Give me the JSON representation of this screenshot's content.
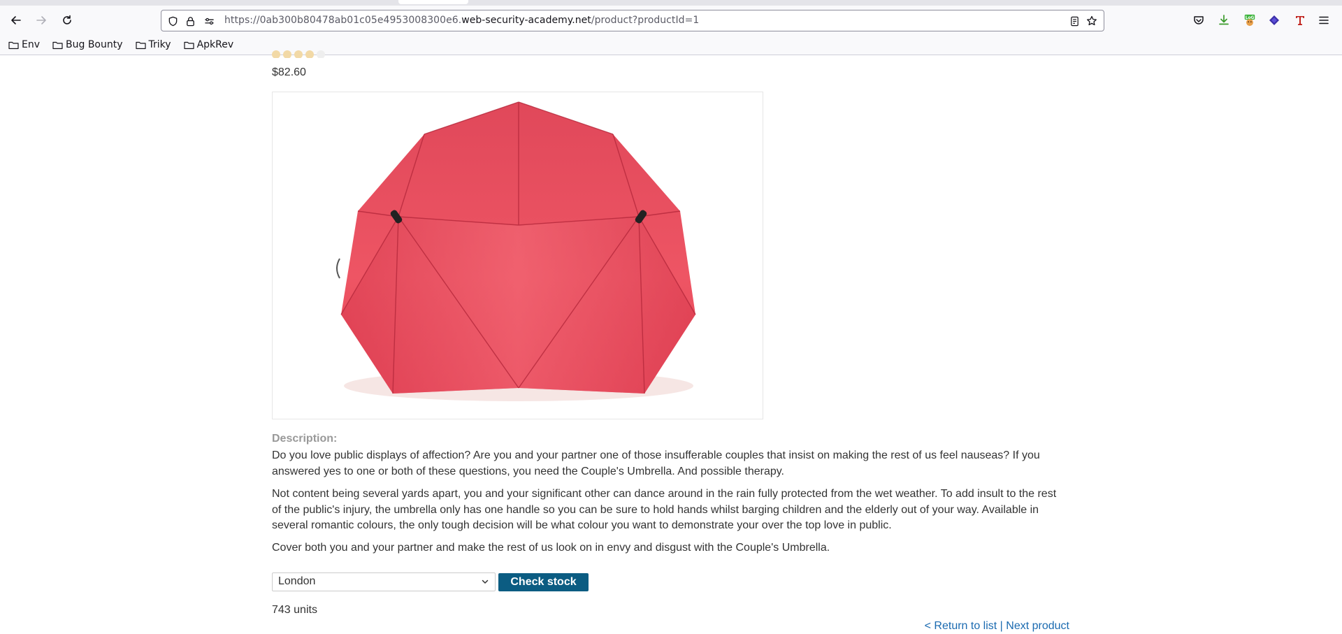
{
  "browser": {
    "url_prefix": "https://0ab300b80478ab01c05e4953008300e6.",
    "url_host": "web-security-academy.net",
    "url_path": "/product?productId=1",
    "bookmarks": [
      "Env",
      "Bug Bounty",
      "Triky",
      "ApkRev"
    ],
    "extension_badge": "LoG"
  },
  "product": {
    "price": "$82.60",
    "image_alt": "Couple's Umbrella",
    "rating_stars": 4
  },
  "description": {
    "heading": "Description:",
    "paragraphs": [
      "Do you love public displays of affection? Are you and your partner one of those insufferable couples that insist on making the rest of us feel nauseas? If you answered yes to one or both of these questions, you need the Couple's Umbrella. And possible therapy.",
      "Not content being several yards apart, you and your significant other can dance around in the rain fully protected from the wet weather. To add insult to the rest of the public's injury, the umbrella only has one handle so you can be sure to hold hands whilst barging children and the elderly out of your way. Available in several romantic colours, the only tough decision will be what colour you want to demonstrate your over the top love in public.",
      "Cover both you and your partner and make the rest of us look on in envy and disgust with the Couple's Umbrella."
    ]
  },
  "stock": {
    "selected_store": "London",
    "button_label": "Check stock",
    "result": "743 units"
  },
  "navigation": {
    "return_label": "< Return to list",
    "separator": " | ",
    "next_label": "Next product"
  },
  "colors": {
    "button": "#0b5c82",
    "link": "#1a6ab0",
    "umbrella": "#e84a5f"
  }
}
